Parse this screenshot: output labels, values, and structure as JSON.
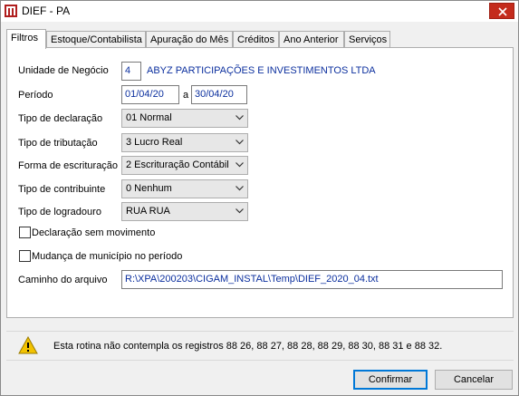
{
  "window": {
    "title": "DIEF - PA"
  },
  "tabs": [
    {
      "label": "Filtros",
      "active": true
    },
    {
      "label": "Estoque/Contabilista",
      "active": false
    },
    {
      "label": "Apuração do Mês",
      "active": false
    },
    {
      "label": "Créditos",
      "active": false
    },
    {
      "label": "Ano Anterior",
      "active": false
    },
    {
      "label": "Serviços",
      "active": false
    }
  ],
  "form": {
    "unidade": {
      "label": "Unidade de Negócio",
      "code": "4",
      "name": "ABYZ PARTICIPAÇÕES E INVESTIMENTOS LTDA"
    },
    "periodo": {
      "label": "Período",
      "start": "01/04/20",
      "separator": "a",
      "end": "30/04/20"
    },
    "tipo_declaracao": {
      "label": "Tipo de declaração",
      "value": "01 Normal"
    },
    "tipo_tributacao": {
      "label": "Tipo de tributação",
      "value": "3 Lucro Real"
    },
    "forma_escrituracao": {
      "label": "Forma de escrituração",
      "value": "2 Escrituração Contábil"
    },
    "tipo_contribuinte": {
      "label": "Tipo de contribuinte",
      "value": "0 Nenhum"
    },
    "tipo_logradouro": {
      "label": "Tipo de logradouro",
      "value": "RUA RUA"
    },
    "declaracao_sem_movimento": {
      "label": "Declaração sem movimento",
      "checked": false
    },
    "mudanca_municipio": {
      "label": "Mudança de município no período",
      "checked": false
    },
    "caminho": {
      "label": "Caminho do arquivo",
      "value": "R:\\XPA\\200203\\CIGAM_INSTAL\\Temp\\DIEF_2020_04.txt"
    }
  },
  "info": {
    "icon": "warning-icon",
    "text": "Esta rotina não contempla os registros 88 26, 88 27, 88 28, 88 29, 88 30, 88 31 e 88 32."
  },
  "buttons": {
    "confirm": "Confirmar",
    "cancel": "Cancelar"
  },
  "colors": {
    "close": "#c42b1c",
    "value_text": "#0b2f9e",
    "accent": "#0078d7",
    "warning": "#f2c200"
  }
}
